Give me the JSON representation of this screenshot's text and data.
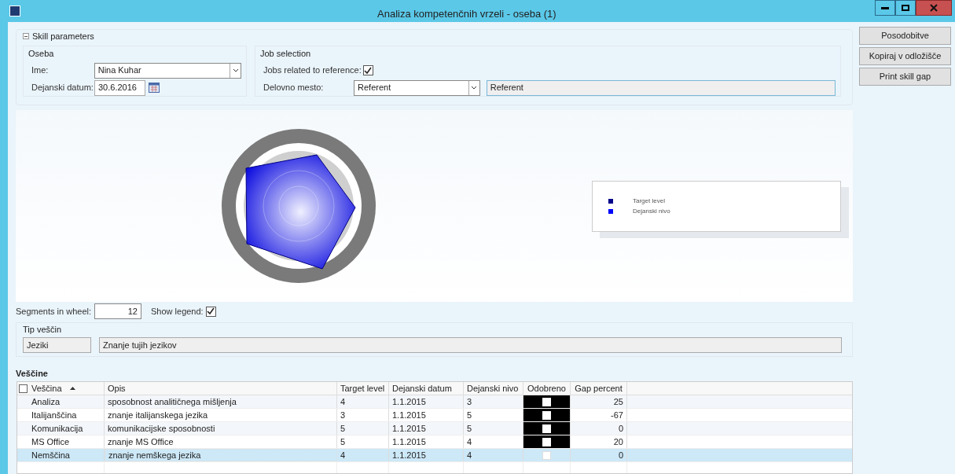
{
  "window": {
    "title": "Analiza kompetenčnih vrzeli - oseba (1)"
  },
  "skill_parameters": {
    "title": "Skill parameters",
    "expanded": true,
    "oseba": {
      "title": "Oseba",
      "name_label": "Ime:",
      "name_value": "Nina Kuhar",
      "date_label": "Dejanski datum:",
      "date_value": "30.6.2016"
    },
    "job_selection": {
      "title": "Job selection",
      "related_label": "Jobs related to reference:",
      "related_checked": true,
      "job_label": "Delovno mesto:",
      "job_value": "Referent",
      "job_name": "Referent"
    }
  },
  "legend": {
    "items": [
      {
        "label": "Target level",
        "color": "#00008b"
      },
      {
        "label": "Dejanski nivo",
        "color": "#0000ff"
      }
    ]
  },
  "segments": {
    "label": "Segments in wheel:",
    "value": "12",
    "legend_label": "Show legend:",
    "legend_checked": true
  },
  "skill_type": {
    "title": "Tip veščin",
    "code": "Jeziki",
    "name": "Znanje tujih jezikov"
  },
  "table": {
    "title": "Veščine",
    "all_selected": false,
    "columns": [
      "Veščina",
      "Opis",
      "Target level",
      "Dejanski datum",
      "Dejanski nivo",
      "Odobreno",
      "Gap percent"
    ],
    "rows": [
      {
        "skill": "Analiza",
        "desc": "sposobnost analitičnega mišljenja",
        "target": "4",
        "date": "1.1.2015",
        "level": "3",
        "approved": false,
        "gap": "25",
        "selected": false
      },
      {
        "skill": "Italijanščina",
        "desc": "znanje italijanskega jezika",
        "target": "3",
        "date": "1.1.2015",
        "level": "5",
        "approved": false,
        "gap": "-67",
        "selected": false
      },
      {
        "skill": "Komunikacija",
        "desc": "komunikacijske sposobnosti",
        "target": "5",
        "date": "1.1.2015",
        "level": "5",
        "approved": false,
        "gap": "0",
        "selected": false
      },
      {
        "skill": "MS Office",
        "desc": "znanje MS Office",
        "target": "5",
        "date": "1.1.2015",
        "level": "4",
        "approved": false,
        "gap": "20",
        "selected": false
      },
      {
        "skill": "Nemščina",
        "desc": "znanje nemškega jezika",
        "target": "4",
        "date": "1.1.2015",
        "level": "4",
        "approved": false,
        "gap": "0",
        "selected": true
      }
    ]
  },
  "buttons": [
    "Posodobitve",
    "Kopiraj v odložišče",
    "Print skill gap"
  ]
}
